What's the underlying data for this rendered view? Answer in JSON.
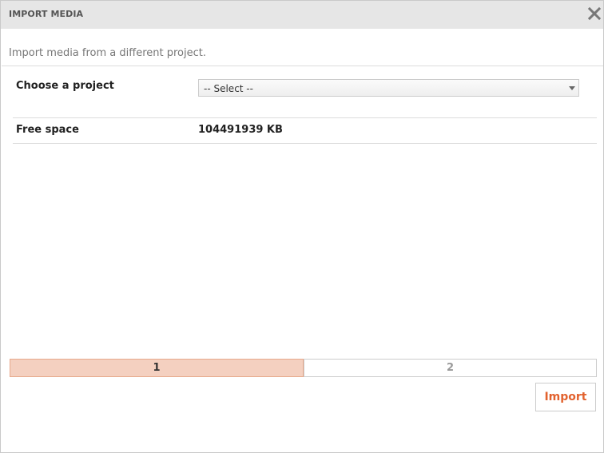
{
  "dialog": {
    "title": "IMPORT MEDIA",
    "close_icon": "close-icon",
    "description": "Import media from a different project."
  },
  "form": {
    "project_label": "Choose a project",
    "project_select_value": "-- Select --",
    "free_space_label": "Free space",
    "free_space_value": "104491939 KB"
  },
  "steps": {
    "items": [
      "1",
      "2"
    ],
    "active_index": 0
  },
  "actions": {
    "import_label": "Import"
  },
  "colors": {
    "accent": "#e2622e",
    "active_step_bg": "#f4d0c0",
    "titlebar_bg": "#e6e6e6"
  }
}
